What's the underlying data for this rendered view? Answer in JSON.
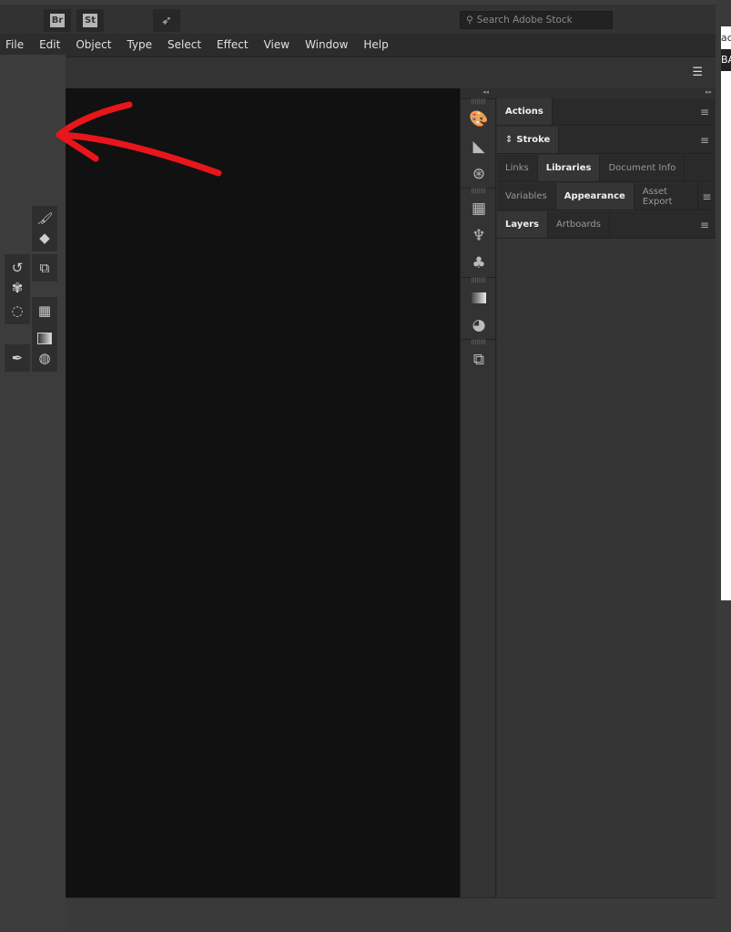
{
  "app_buttons": [
    {
      "label": "Br"
    },
    {
      "label": "St"
    }
  ],
  "search": {
    "placeholder": "Search Adobe Stock"
  },
  "menu": [
    "File",
    "Edit",
    "Object",
    "Type",
    "Select",
    "Effect",
    "View",
    "Window",
    "Help"
  ],
  "panels": {
    "group1": {
      "tabs": [
        "Actions"
      ]
    },
    "group2": {
      "tabs": [
        "Stroke"
      ]
    },
    "group3": {
      "tabs": [
        "Links",
        "Libraries",
        "Document Info"
      ],
      "active": "Libraries"
    },
    "group4": {
      "tabs": [
        "Variables",
        "Appearance",
        "Asset Export"
      ],
      "active": "Appearance"
    },
    "group5": {
      "tabs": [
        "Layers",
        "Artboards"
      ],
      "active": "Layers"
    }
  },
  "background_window": {
    "text1": "ac",
    "text2": "BA"
  },
  "annotation": {
    "color": "#e8161b",
    "shape": "arrow pointing left"
  }
}
